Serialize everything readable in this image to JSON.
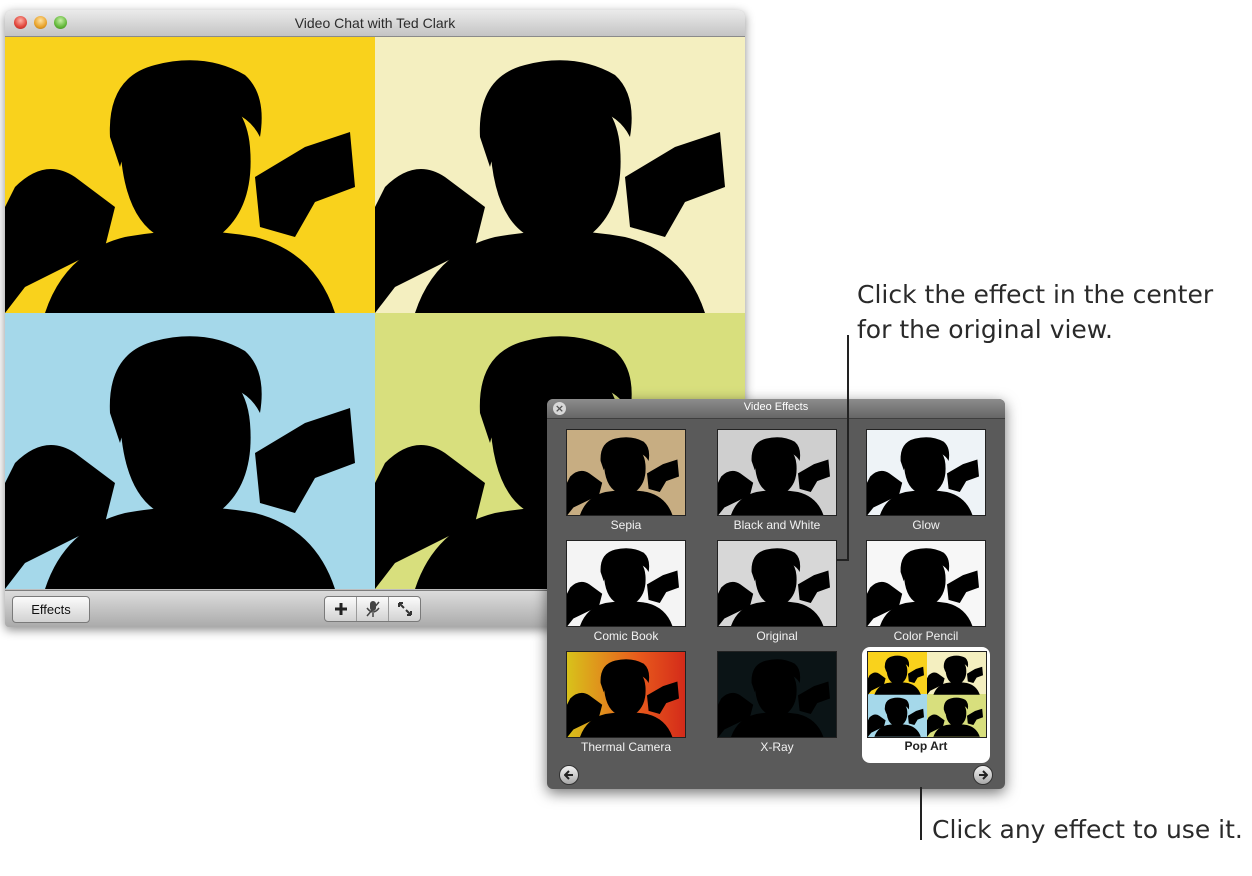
{
  "window": {
    "title": "Video Chat with Ted Clark"
  },
  "toolbar": {
    "effects_label": "Effects",
    "buttons": [
      "add-icon",
      "microphone-mute-icon",
      "fullscreen-icon"
    ]
  },
  "panel": {
    "title": "Video Effects",
    "effects": [
      {
        "label": "Sepia"
      },
      {
        "label": "Black and White"
      },
      {
        "label": "Glow"
      },
      {
        "label": "Comic Book"
      },
      {
        "label": "Original"
      },
      {
        "label": "Color Pencil"
      },
      {
        "label": "Thermal Camera"
      },
      {
        "label": "X-Ray"
      },
      {
        "label": "Pop Art",
        "selected": true
      }
    ]
  },
  "callouts": {
    "center_line1": "Click the effect in the center",
    "center_line2": "for the original view.",
    "any": "Click any effect to use it."
  },
  "colors": {
    "pop_quadrants": [
      "#f9d21c",
      "#f4efc0",
      "#a5d8ea",
      "#d8df7d"
    ],
    "panel_bg": "#5a5a5a"
  }
}
